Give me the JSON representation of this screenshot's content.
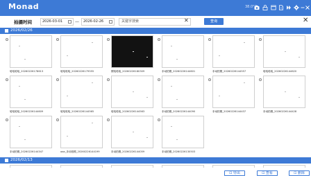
{
  "app": {
    "title": "Monad"
  },
  "titlebar": {
    "temperature": "38.0°C",
    "icons": [
      "camera-icon",
      "lock-icon",
      "window-icon",
      "export-file-icon",
      "forward-icon",
      "settings-icon",
      "minimize-icon",
      "close-icon",
      "menu-icon"
    ]
  },
  "filter": {
    "label": "拍摄时间",
    "start_date": "2026-03-01",
    "end_date": "2026-02-26",
    "separator": "—",
    "search_placeholder": "关键字搜索",
    "query_label": "查询"
  },
  "groups": [
    {
      "date": "2026/02/26",
      "items": [
        {
          "caption": "哈哈哈哈_20260226178613",
          "dark": false
        },
        {
          "caption": "哈哈哈哈_20260226179555",
          "dark": false
        },
        {
          "caption": "照哈哈哈_20260226180309",
          "dark": true
        },
        {
          "caption": "手动拍照_20260226144601",
          "dark": false
        },
        {
          "caption": "手动拍照_20260226144557",
          "dark": false
        },
        {
          "caption": "哈哈哈哈_20260226144620",
          "dark": false
        },
        {
          "caption": "哈哈哈哈_20260226144609",
          "dark": false
        },
        {
          "caption": "哈哈哈哈_20260226144565",
          "dark": false
        },
        {
          "caption": "哈哈哈哈_20260226144563",
          "dark": false
        },
        {
          "caption": "手动拍照_20260226144090",
          "dark": false
        },
        {
          "caption": "手动拍照_20260226144437",
          "dark": false
        },
        {
          "caption": "手动拍照_20260226144428",
          "dark": false
        },
        {
          "caption": "手动拍照_20260226144347",
          "dark": false
        },
        {
          "caption": "aaa_手动拍照_20260226144199",
          "dark": false
        },
        {
          "caption": "手动拍照_20260226144059",
          "dark": false
        },
        {
          "caption": "手动拍照_20260226130503",
          "dark": false
        }
      ]
    },
    {
      "date": "2026/02/13",
      "items": []
    }
  ],
  "footer": {
    "export_label": "导出",
    "view_label": "查看",
    "delete_label": "删除"
  }
}
